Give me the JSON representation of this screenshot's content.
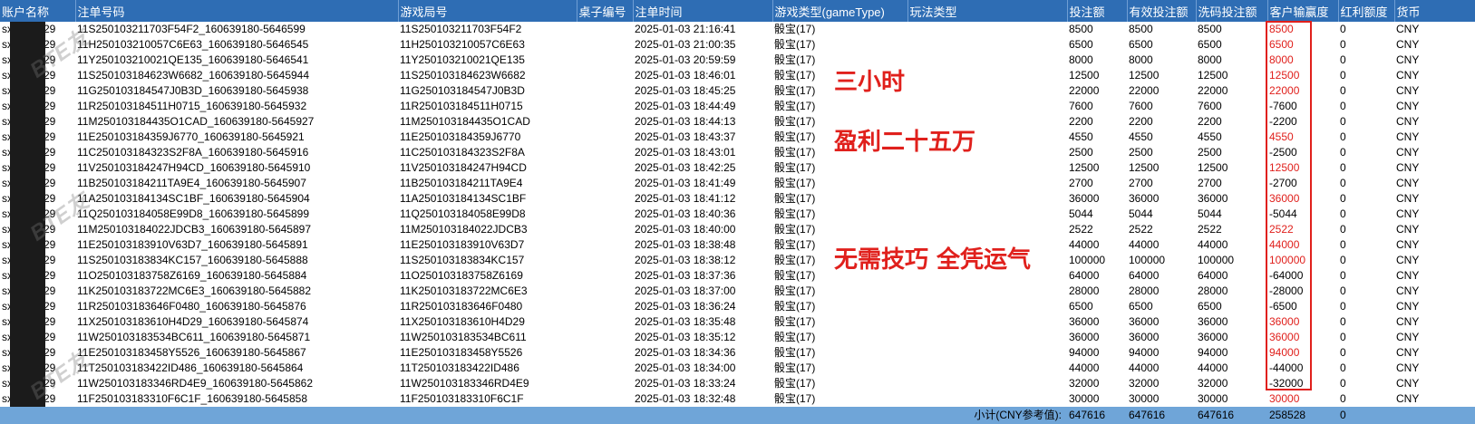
{
  "header": [
    "账户名称",
    "注单号码",
    "游戏局号",
    "桌子编号",
    "注单时间",
    "游戏类型(gameType)",
    "玩法类型",
    "投注额",
    "有效投注额",
    "洗码投注额",
    "客户输赢度",
    "红利额度",
    "货币"
  ],
  "rows": [
    {
      "account": "sx",
      "account_suffix": "29",
      "order_no": "11S250103211703F54F2_160639180-5646599",
      "round_no": "11S250103211703F54F2",
      "table_no": "",
      "time": "2025-01-03 21:16:41",
      "game_type": "骰宝(17)",
      "play_type": "",
      "bet": "8500",
      "valid_bet": "8500",
      "rolling_bet": "8500",
      "win_loss": "8500",
      "bonus": "0",
      "currency": "CNY"
    },
    {
      "account": "sx",
      "account_suffix": "29",
      "order_no": "11H250103210057C6E63_160639180-5646545",
      "round_no": "11H250103210057C6E63",
      "table_no": "",
      "time": "2025-01-03 21:00:35",
      "game_type": "骰宝(17)",
      "play_type": "",
      "bet": "6500",
      "valid_bet": "6500",
      "rolling_bet": "6500",
      "win_loss": "6500",
      "bonus": "0",
      "currency": "CNY"
    },
    {
      "account": "sx",
      "account_suffix": "29",
      "order_no": "11Y250103210021QE135_160639180-5646541",
      "round_no": "11Y250103210021QE135",
      "table_no": "",
      "time": "2025-01-03 20:59:59",
      "game_type": "骰宝(17)",
      "play_type": "",
      "bet": "8000",
      "valid_bet": "8000",
      "rolling_bet": "8000",
      "win_loss": "8000",
      "bonus": "0",
      "currency": "CNY"
    },
    {
      "account": "sx",
      "account_suffix": "29",
      "order_no": "11S250103184623W6682_160639180-5645944",
      "round_no": "11S250103184623W6682",
      "table_no": "",
      "time": "2025-01-03 18:46:01",
      "game_type": "骰宝(17)",
      "play_type": "",
      "bet": "12500",
      "valid_bet": "12500",
      "rolling_bet": "12500",
      "win_loss": "12500",
      "bonus": "0",
      "currency": "CNY"
    },
    {
      "account": "sx",
      "account_suffix": "29",
      "order_no": "11G250103184547J0B3D_160639180-5645938",
      "round_no": "11G250103184547J0B3D",
      "table_no": "",
      "time": "2025-01-03 18:45:25",
      "game_type": "骰宝(17)",
      "play_type": "",
      "bet": "22000",
      "valid_bet": "22000",
      "rolling_bet": "22000",
      "win_loss": "22000",
      "bonus": "0",
      "currency": "CNY"
    },
    {
      "account": "sx",
      "account_suffix": "29",
      "order_no": "11R250103184511H0715_160639180-5645932",
      "round_no": "11R250103184511H0715",
      "table_no": "",
      "time": "2025-01-03 18:44:49",
      "game_type": "骰宝(17)",
      "play_type": "",
      "bet": "7600",
      "valid_bet": "7600",
      "rolling_bet": "7600",
      "win_loss": "-7600",
      "bonus": "0",
      "currency": "CNY"
    },
    {
      "account": "sx",
      "account_suffix": "29",
      "order_no": "11M250103184435O1CAD_160639180-5645927",
      "round_no": "11M250103184435O1CAD",
      "table_no": "",
      "time": "2025-01-03 18:44:13",
      "game_type": "骰宝(17)",
      "play_type": "",
      "bet": "2200",
      "valid_bet": "2200",
      "rolling_bet": "2200",
      "win_loss": "-2200",
      "bonus": "0",
      "currency": "CNY"
    },
    {
      "account": "sx",
      "account_suffix": "29",
      "order_no": "11E250103184359J6770_160639180-5645921",
      "round_no": "11E250103184359J6770",
      "table_no": "",
      "time": "2025-01-03 18:43:37",
      "game_type": "骰宝(17)",
      "play_type": "",
      "bet": "4550",
      "valid_bet": "4550",
      "rolling_bet": "4550",
      "win_loss": "4550",
      "bonus": "0",
      "currency": "CNY"
    },
    {
      "account": "sx",
      "account_suffix": "29",
      "order_no": "11C250103184323S2F8A_160639180-5645916",
      "round_no": "11C250103184323S2F8A",
      "table_no": "",
      "time": "2025-01-03 18:43:01",
      "game_type": "骰宝(17)",
      "play_type": "",
      "bet": "2500",
      "valid_bet": "2500",
      "rolling_bet": "2500",
      "win_loss": "-2500",
      "bonus": "0",
      "currency": "CNY"
    },
    {
      "account": "sx",
      "account_suffix": "29",
      "order_no": "11V250103184247H94CD_160639180-5645910",
      "round_no": "11V250103184247H94CD",
      "table_no": "",
      "time": "2025-01-03 18:42:25",
      "game_type": "骰宝(17)",
      "play_type": "",
      "bet": "12500",
      "valid_bet": "12500",
      "rolling_bet": "12500",
      "win_loss": "12500",
      "bonus": "0",
      "currency": "CNY"
    },
    {
      "account": "sx",
      "account_suffix": "29",
      "order_no": "11B250103184211TA9E4_160639180-5645907",
      "round_no": "11B250103184211TA9E4",
      "table_no": "",
      "time": "2025-01-03 18:41:49",
      "game_type": "骰宝(17)",
      "play_type": "",
      "bet": "2700",
      "valid_bet": "2700",
      "rolling_bet": "2700",
      "win_loss": "-2700",
      "bonus": "0",
      "currency": "CNY"
    },
    {
      "account": "sx",
      "account_suffix": "29",
      "order_no": "11A250103184134SC1BF_160639180-5645904",
      "round_no": "11A250103184134SC1BF",
      "table_no": "",
      "time": "2025-01-03 18:41:12",
      "game_type": "骰宝(17)",
      "play_type": "",
      "bet": "36000",
      "valid_bet": "36000",
      "rolling_bet": "36000",
      "win_loss": "36000",
      "bonus": "0",
      "currency": "CNY"
    },
    {
      "account": "sx",
      "account_suffix": "29",
      "order_no": "11Q250103184058E99D8_160639180-5645899",
      "round_no": "11Q250103184058E99D8",
      "table_no": "",
      "time": "2025-01-03 18:40:36",
      "game_type": "骰宝(17)",
      "play_type": "",
      "bet": "5044",
      "valid_bet": "5044",
      "rolling_bet": "5044",
      "win_loss": "-5044",
      "bonus": "0",
      "currency": "CNY"
    },
    {
      "account": "sx",
      "account_suffix": "29",
      "order_no": "11M250103184022JDCB3_160639180-5645897",
      "round_no": "11M250103184022JDCB3",
      "table_no": "",
      "time": "2025-01-03 18:40:00",
      "game_type": "骰宝(17)",
      "play_type": "",
      "bet": "2522",
      "valid_bet": "2522",
      "rolling_bet": "2522",
      "win_loss": "2522",
      "bonus": "0",
      "currency": "CNY"
    },
    {
      "account": "sx",
      "account_suffix": "29",
      "order_no": "11E250103183910V63D7_160639180-5645891",
      "round_no": "11E250103183910V63D7",
      "table_no": "",
      "time": "2025-01-03 18:38:48",
      "game_type": "骰宝(17)",
      "play_type": "",
      "bet": "44000",
      "valid_bet": "44000",
      "rolling_bet": "44000",
      "win_loss": "44000",
      "bonus": "0",
      "currency": "CNY"
    },
    {
      "account": "sx",
      "account_suffix": "29",
      "order_no": "11S250103183834KC157_160639180-5645888",
      "round_no": "11S250103183834KC157",
      "table_no": "",
      "time": "2025-01-03 18:38:12",
      "game_type": "骰宝(17)",
      "play_type": "",
      "bet": "100000",
      "valid_bet": "100000",
      "rolling_bet": "100000",
      "win_loss": "100000",
      "bonus": "0",
      "currency": "CNY"
    },
    {
      "account": "sx",
      "account_suffix": "29",
      "order_no": "11O250103183758Z6169_160639180-5645884",
      "round_no": "11O250103183758Z6169",
      "table_no": "",
      "time": "2025-01-03 18:37:36",
      "game_type": "骰宝(17)",
      "play_type": "",
      "bet": "64000",
      "valid_bet": "64000",
      "rolling_bet": "64000",
      "win_loss": "-64000",
      "bonus": "0",
      "currency": "CNY"
    },
    {
      "account": "sx",
      "account_suffix": "29",
      "order_no": "11K250103183722MC6E3_160639180-5645882",
      "round_no": "11K250103183722MC6E3",
      "table_no": "",
      "time": "2025-01-03 18:37:00",
      "game_type": "骰宝(17)",
      "play_type": "",
      "bet": "28000",
      "valid_bet": "28000",
      "rolling_bet": "28000",
      "win_loss": "-28000",
      "bonus": "0",
      "currency": "CNY"
    },
    {
      "account": "sx",
      "account_suffix": "29",
      "order_no": "11R250103183646F0480_160639180-5645876",
      "round_no": "11R250103183646F0480",
      "table_no": "",
      "time": "2025-01-03 18:36:24",
      "game_type": "骰宝(17)",
      "play_type": "",
      "bet": "6500",
      "valid_bet": "6500",
      "rolling_bet": "6500",
      "win_loss": "-6500",
      "bonus": "0",
      "currency": "CNY"
    },
    {
      "account": "sx",
      "account_suffix": "29",
      "order_no": "11X250103183610H4D29_160639180-5645874",
      "round_no": "11X250103183610H4D29",
      "table_no": "",
      "time": "2025-01-03 18:35:48",
      "game_type": "骰宝(17)",
      "play_type": "",
      "bet": "36000",
      "valid_bet": "36000",
      "rolling_bet": "36000",
      "win_loss": "36000",
      "bonus": "0",
      "currency": "CNY"
    },
    {
      "account": "sx",
      "account_suffix": "29",
      "order_no": "11W250103183534BC611_160639180-5645871",
      "round_no": "11W250103183534BC611",
      "table_no": "",
      "time": "2025-01-03 18:35:12",
      "game_type": "骰宝(17)",
      "play_type": "",
      "bet": "36000",
      "valid_bet": "36000",
      "rolling_bet": "36000",
      "win_loss": "36000",
      "bonus": "0",
      "currency": "CNY"
    },
    {
      "account": "sx",
      "account_suffix": "29",
      "order_no": "11E250103183458Y5526_160639180-5645867",
      "round_no": "11E250103183458Y5526",
      "table_no": "",
      "time": "2025-01-03 18:34:36",
      "game_type": "骰宝(17)",
      "play_type": "",
      "bet": "94000",
      "valid_bet": "94000",
      "rolling_bet": "94000",
      "win_loss": "94000",
      "bonus": "0",
      "currency": "CNY"
    },
    {
      "account": "sx",
      "account_suffix": "29",
      "order_no": "11T250103183422ID486_160639180-5645864",
      "round_no": "11T250103183422ID486",
      "table_no": "",
      "time": "2025-01-03 18:34:00",
      "game_type": "骰宝(17)",
      "play_type": "",
      "bet": "44000",
      "valid_bet": "44000",
      "rolling_bet": "44000",
      "win_loss": "-44000",
      "bonus": "0",
      "currency": "CNY"
    },
    {
      "account": "sx",
      "account_suffix": "29",
      "order_no": "11W250103183346RD4E9_160639180-5645862",
      "round_no": "11W250103183346RD4E9",
      "table_no": "",
      "time": "2025-01-03 18:33:24",
      "game_type": "骰宝(17)",
      "play_type": "",
      "bet": "32000",
      "valid_bet": "32000",
      "rolling_bet": "32000",
      "win_loss": "-32000",
      "bonus": "0",
      "currency": "CNY"
    },
    {
      "account": "sx",
      "account_suffix": "29",
      "order_no": "11F250103183310F6C1F_160639180-5645858",
      "round_no": "11F250103183310F6C1F",
      "table_no": "",
      "time": "2025-01-03 18:32:48",
      "game_type": "骰宝(17)",
      "play_type": "",
      "bet": "30000",
      "valid_bet": "30000",
      "rolling_bet": "30000",
      "win_loss": "30000",
      "bonus": "0",
      "currency": "CNY"
    }
  ],
  "subtotal": {
    "label": "小计(CNY参考值):",
    "bet": "647616",
    "valid_bet": "647616",
    "rolling_bet": "647616",
    "win_loss": "258528",
    "bonus": "0"
  },
  "annotations": [
    "三小时",
    "盈利二十五万",
    "无需技巧 全凭运气"
  ],
  "watermark": "BTE友",
  "colors": {
    "header_bg": "#2e6db4",
    "subtotal_bg": "#6fa5d8",
    "positive": "#e0201c",
    "highlight": "#e0201c"
  }
}
